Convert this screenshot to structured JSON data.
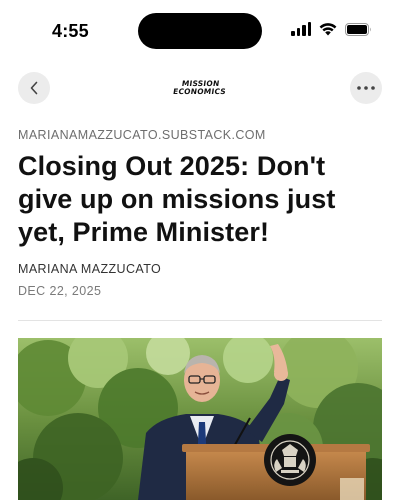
{
  "status_bar": {
    "time": "4:55",
    "icons": [
      "cellular-signal-icon",
      "wifi-icon",
      "battery-icon"
    ]
  },
  "nav": {
    "back_icon": "chevron-left-icon",
    "more_icon": "more-dots-icon",
    "logo_line1": "MISSION",
    "logo_line2": "ECONOMICS"
  },
  "article": {
    "source": "MARIANAMAZZUCATO.SUBSTACK.COM",
    "title": "Closing Out 2025: Don't give up on missions just yet, Prime Minister!",
    "author": "MARIANA MAZZUCATO",
    "date": "DEC 22, 2025"
  },
  "colors": {
    "nav_button_bg": "#ececec",
    "muted_text": "#6e6e6e"
  }
}
